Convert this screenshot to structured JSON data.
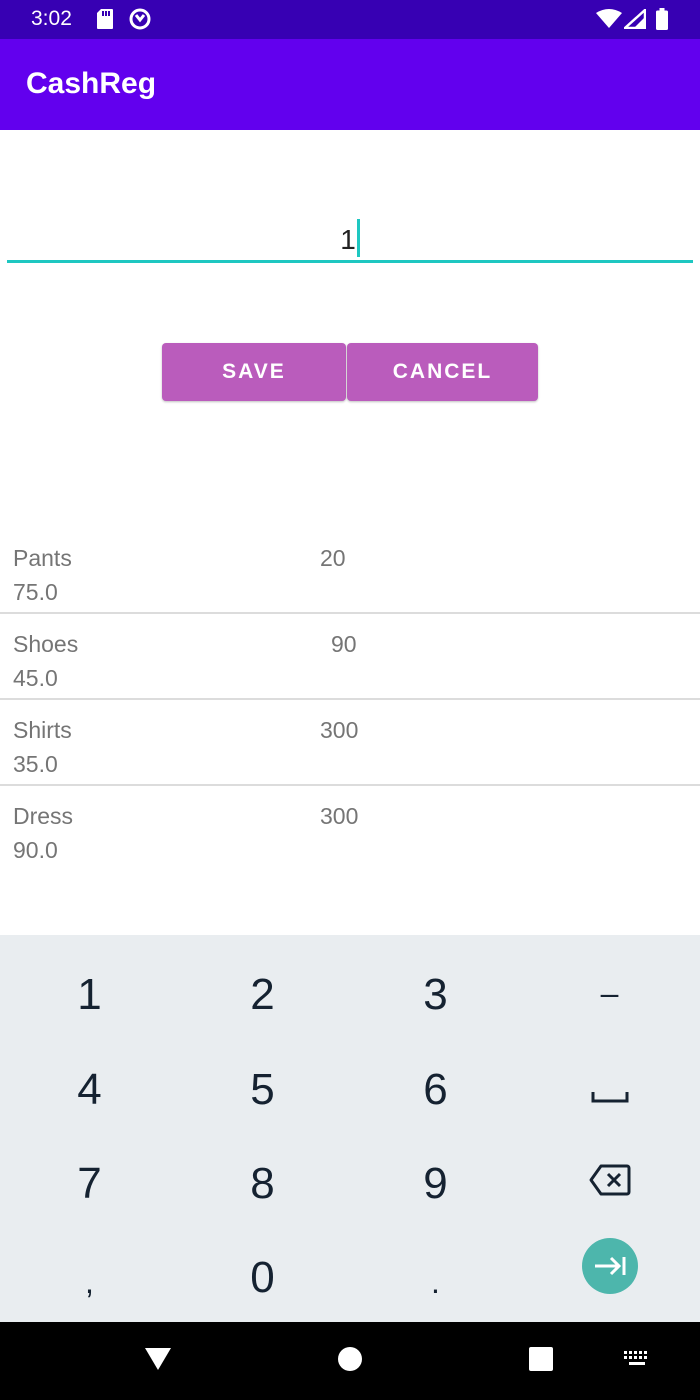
{
  "status_bar": {
    "time": "3:02",
    "left_icons": [
      "sd-card-icon",
      "data-saver-icon"
    ],
    "right_icons": [
      "wifi-icon",
      "signal-icon",
      "battery-icon"
    ]
  },
  "app": {
    "title": "CashReg"
  },
  "colors": {
    "status_bar": "#3700b3",
    "app_bar": "#6200ee",
    "button": "#ba5cbc",
    "input_underline": "#1ec7c1",
    "keyboard_bg": "#e9edf0",
    "enter_key": "#4db6ac"
  },
  "input": {
    "value": "1"
  },
  "buttons": {
    "save": "SAVE",
    "cancel": "CANCEL"
  },
  "items": [
    {
      "name": "Pants",
      "quantity": "20",
      "price": "75.0"
    },
    {
      "name": "Shoes",
      "quantity": "90",
      "price": "45.0"
    },
    {
      "name": "Shirts",
      "quantity": "300",
      "price": "35.0"
    },
    {
      "name": "Dress",
      "quantity": "300",
      "price": "90.0"
    }
  ],
  "keyboard": {
    "row1": [
      "1",
      "2",
      "3",
      "–"
    ],
    "row2": [
      "4",
      "5",
      "6"
    ],
    "row3": [
      "7",
      "8",
      "9"
    ],
    "row4": [
      ",",
      "0",
      "."
    ],
    "icons": [
      "space-key-icon",
      "backspace-icon",
      "next-field-icon"
    ]
  },
  "nav_bar": {
    "icons": [
      "back-icon",
      "home-icon",
      "recents-icon",
      "keyboard-switch-icon"
    ]
  }
}
